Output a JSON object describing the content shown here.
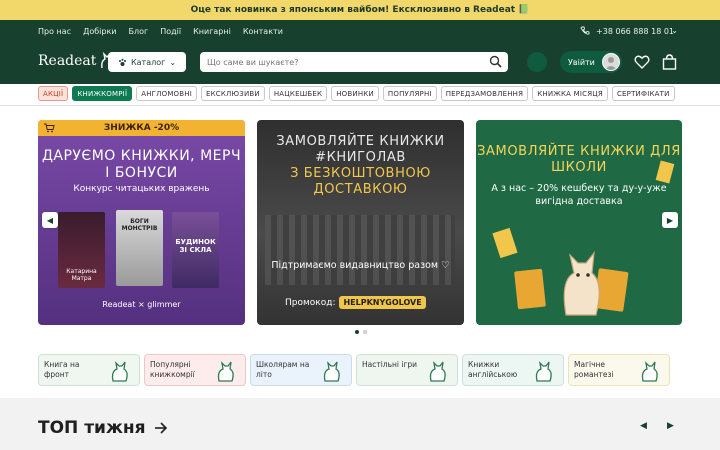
{
  "promo_bar": {
    "text": "Оце так новинка з японським вайбом! Ексклюзивно в Readeat 📗"
  },
  "topnav": {
    "links": [
      "Про нас",
      "Добірки",
      "Блог",
      "Події",
      "Книгарні",
      "Контакти"
    ],
    "phone": "+38 066 888 18 01"
  },
  "header": {
    "logo": "Readeat",
    "catalog_label": "Каталог",
    "search_placeholder": "Що саме ви шукаєте?",
    "login_label": "Увійти"
  },
  "categories": [
    {
      "label": "АКЦІЇ",
      "style": "sale"
    },
    {
      "label": "КНИЖКОМРІЇ",
      "style": "active"
    },
    {
      "label": "АНГЛОМОВНІ",
      "style": ""
    },
    {
      "label": "ЕКСКЛЮЗИВИ",
      "style": ""
    },
    {
      "label": "НАЦКЕШБЕК",
      "style": ""
    },
    {
      "label": "НОВИНКИ",
      "style": ""
    },
    {
      "label": "ПОПУЛЯРНІ",
      "style": ""
    },
    {
      "label": "ПЕРЕДЗАМОВЛЕННЯ",
      "style": ""
    },
    {
      "label": "КНИЖКА МІСЯЦЯ",
      "style": ""
    },
    {
      "label": "СЕРТИФІКАТИ",
      "style": ""
    }
  ],
  "slides": {
    "s1": {
      "badge": "ЗНИЖКА -20%",
      "title": "ДАРУЄМО КНИЖКИ, МЕРЧ І БОНУСИ",
      "subtitle": "Конкурс читацьких вражень",
      "book1": "Катарина Матра",
      "book2": "БОГИ МОНСТРІВ",
      "book3": "БУДИНОК ЗІ СКЛА",
      "brand": "Readeat × glimmer"
    },
    "s2": {
      "title": "ЗАМОВЛЯЙТЕ КНИЖКИ #КНИГОЛАВ",
      "title_accent": "З БЕЗКОШТОВНОЮ ДОСТАВКОЮ",
      "subtitle": "Підтримаємо видавництво разом ♡",
      "promo_label": "Промокод:",
      "promo_code": "HELPKNYGOLOVE"
    },
    "s3": {
      "title": "ЗАМОВЛЯЙТЕ КНИЖКИ ДЛЯ ШКОЛИ",
      "subtitle": "А з нас – 20% кешбеку та ду-у-уже вигідна доставка"
    }
  },
  "tiles": [
    {
      "label": "Книга на фронт"
    },
    {
      "label": "Популярні книжкомрії"
    },
    {
      "label": "Школярам на літо"
    },
    {
      "label": "Настільні ігри"
    },
    {
      "label": "Книжки англійською"
    },
    {
      "label": "Магічне романтезі"
    }
  ],
  "top_section": {
    "title": "ТОП тижня"
  },
  "colors": {
    "brand_dark": "#17402f",
    "accent_green": "#0e7a51",
    "promo_yellow": "#f2d86a"
  },
  "icons": [
    "phone-icon",
    "paw-icon",
    "search-icon",
    "heart-icon",
    "bag-icon",
    "cart-icon",
    "arrow-right-icon"
  ]
}
